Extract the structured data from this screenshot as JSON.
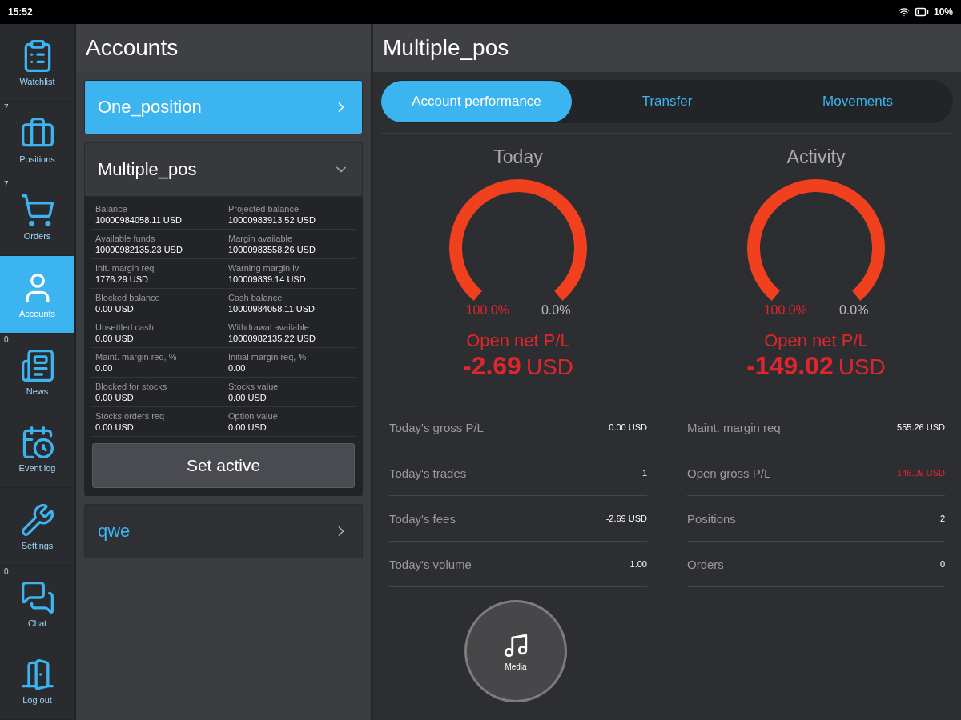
{
  "status_bar": {
    "time": "15:52",
    "battery": "10%"
  },
  "nav": [
    {
      "label": "Watchlist",
      "selected": false
    },
    {
      "label": "Positions",
      "badge": "7",
      "selected": false
    },
    {
      "label": "Orders",
      "badge": "7",
      "selected": false
    },
    {
      "label": "Accounts",
      "selected": true
    },
    {
      "label": "News",
      "badge": "0",
      "selected": false
    },
    {
      "label": "Event log",
      "selected": false
    },
    {
      "label": "Settings",
      "selected": false
    },
    {
      "label": "Chat",
      "badge": "0",
      "selected": false
    },
    {
      "label": "Log out",
      "selected": false
    }
  ],
  "accounts_panel": {
    "title": "Accounts",
    "accounts": [
      {
        "name": "One_position",
        "selected": true,
        "expanded": false
      },
      {
        "name": "Multiple_pos",
        "selected": false,
        "expanded": true,
        "details": [
          {
            "label": "Balance",
            "value": "10000984058.11 USD"
          },
          {
            "label": "Projected balance",
            "value": "10000983913.52 USD"
          },
          {
            "label": "Available funds",
            "value": "10000982135.23 USD"
          },
          {
            "label": "Margin available",
            "value": "10000983558.26 USD"
          },
          {
            "label": "Init. margin req",
            "value": "1776.29 USD"
          },
          {
            "label": "Warning margin lvl",
            "value": "100009839.14 USD"
          },
          {
            "label": "Blocked balance",
            "value": "0.00 USD"
          },
          {
            "label": "Cash balance",
            "value": "10000984058.11 USD"
          },
          {
            "label": "Unsettled cash",
            "value": "0.00 USD"
          },
          {
            "label": "Withdrawal available",
            "value": "10000982135.22 USD"
          },
          {
            "label": "Maint. margin req, %",
            "value": "0.00"
          },
          {
            "label": "Initial margin req, %",
            "value": "0.00"
          },
          {
            "label": "Blocked for stocks",
            "value": "0.00 USD"
          },
          {
            "label": "Stocks value",
            "value": "0.00 USD"
          },
          {
            "label": "Stocks orders req",
            "value": "0.00 USD"
          },
          {
            "label": "Option value",
            "value": "0.00 USD"
          }
        ],
        "button": "Set active"
      },
      {
        "name": "qwe",
        "selected": false,
        "expanded": false
      }
    ]
  },
  "detail": {
    "title": "Multiple_pos",
    "tabs": [
      {
        "label": "Account performance",
        "selected": true
      },
      {
        "label": "Transfer",
        "selected": false
      },
      {
        "label": "Movements",
        "selected": false
      }
    ],
    "cards": [
      {
        "title": "Today",
        "left_pct": "100.0%",
        "right_pct": "0.0%",
        "pl_label": "Open net P/L",
        "pl_amount": "-2.69",
        "pl_currency": "USD",
        "rows": [
          {
            "label": "Today's gross P/L",
            "value": "0.00 USD",
            "negative": false
          },
          {
            "label": "Today's trades",
            "value": "1",
            "negative": false
          },
          {
            "label": "Today's fees",
            "value": "-2.69 USD",
            "negative": false
          },
          {
            "label": "Today's volume",
            "value": "1.00",
            "negative": false
          }
        ]
      },
      {
        "title": "Activity",
        "left_pct": "100.0%",
        "right_pct": "0.0%",
        "pl_label": "Open net P/L",
        "pl_amount": "-149.02",
        "pl_currency": "USD",
        "rows": [
          {
            "label": "Maint. margin req",
            "value": "555.26 USD",
            "negative": false
          },
          {
            "label": "Open gross P/L",
            "value": "-146.09 USD",
            "negative": true
          },
          {
            "label": "Positions",
            "value": "2",
            "negative": false
          },
          {
            "label": "Orders",
            "value": "0",
            "negative": false
          }
        ]
      }
    ]
  },
  "media_button": {
    "label": "Media"
  }
}
